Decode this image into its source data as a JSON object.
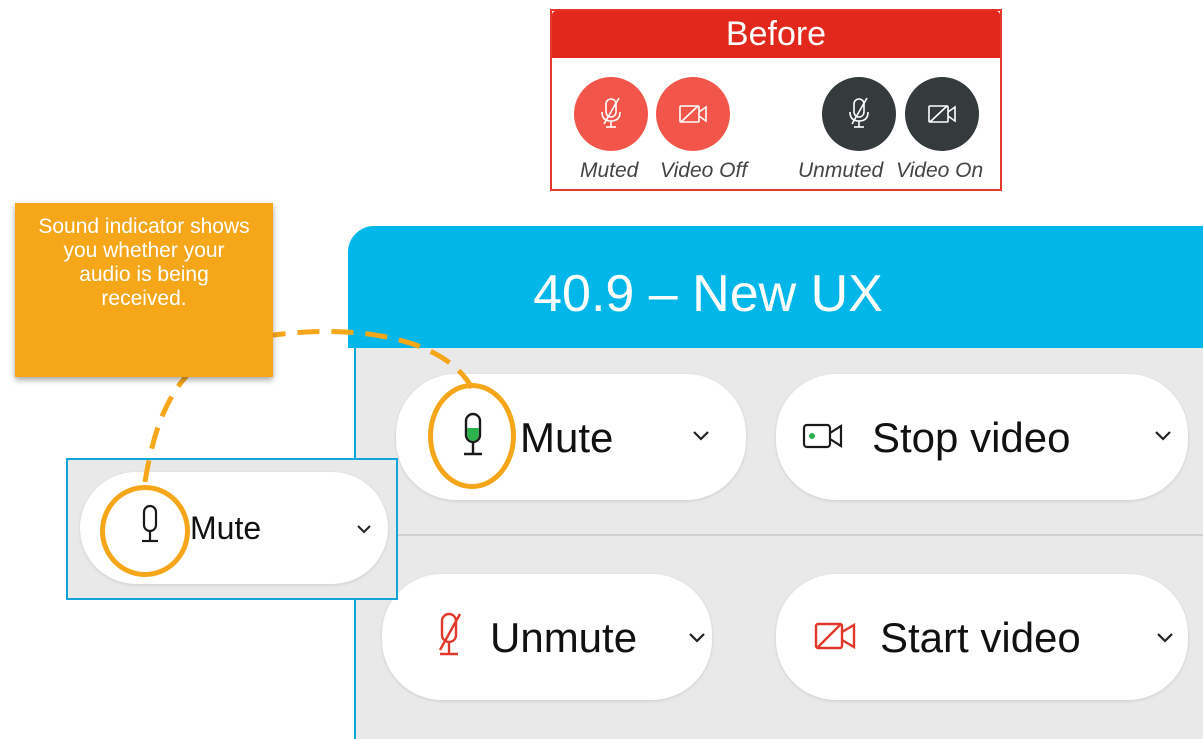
{
  "before": {
    "title": "Before",
    "buttons": [
      {
        "icon": "mic-off-icon",
        "style": "red"
      },
      {
        "icon": "video-off-icon",
        "style": "red"
      },
      {
        "icon": "mic-off-icon",
        "style": "dark"
      },
      {
        "icon": "video-off-icon",
        "style": "dark"
      }
    ],
    "captions": {
      "muted": "Muted",
      "video_off": "Video Off",
      "unmuted": "Unmuted",
      "video_on": "Video On"
    }
  },
  "new_ux": {
    "title": "40.9 – New UX",
    "mute_label": "Mute",
    "stop_video_label": "Stop video",
    "unmute_label": "Unmute",
    "start_video_label": "Start video"
  },
  "callout": {
    "text": "Sound indicator shows you whether your audio is being received."
  },
  "mini": {
    "mute_label": "Mute"
  },
  "colors": {
    "before_red": "#e2271c",
    "button_red": "#f2564a",
    "button_dark": "#353a3d",
    "header_blue": "#01b7ea",
    "callout_orange": "#f6a619",
    "mic_green": "#2bb24c",
    "icon_red": "#e2372b"
  }
}
